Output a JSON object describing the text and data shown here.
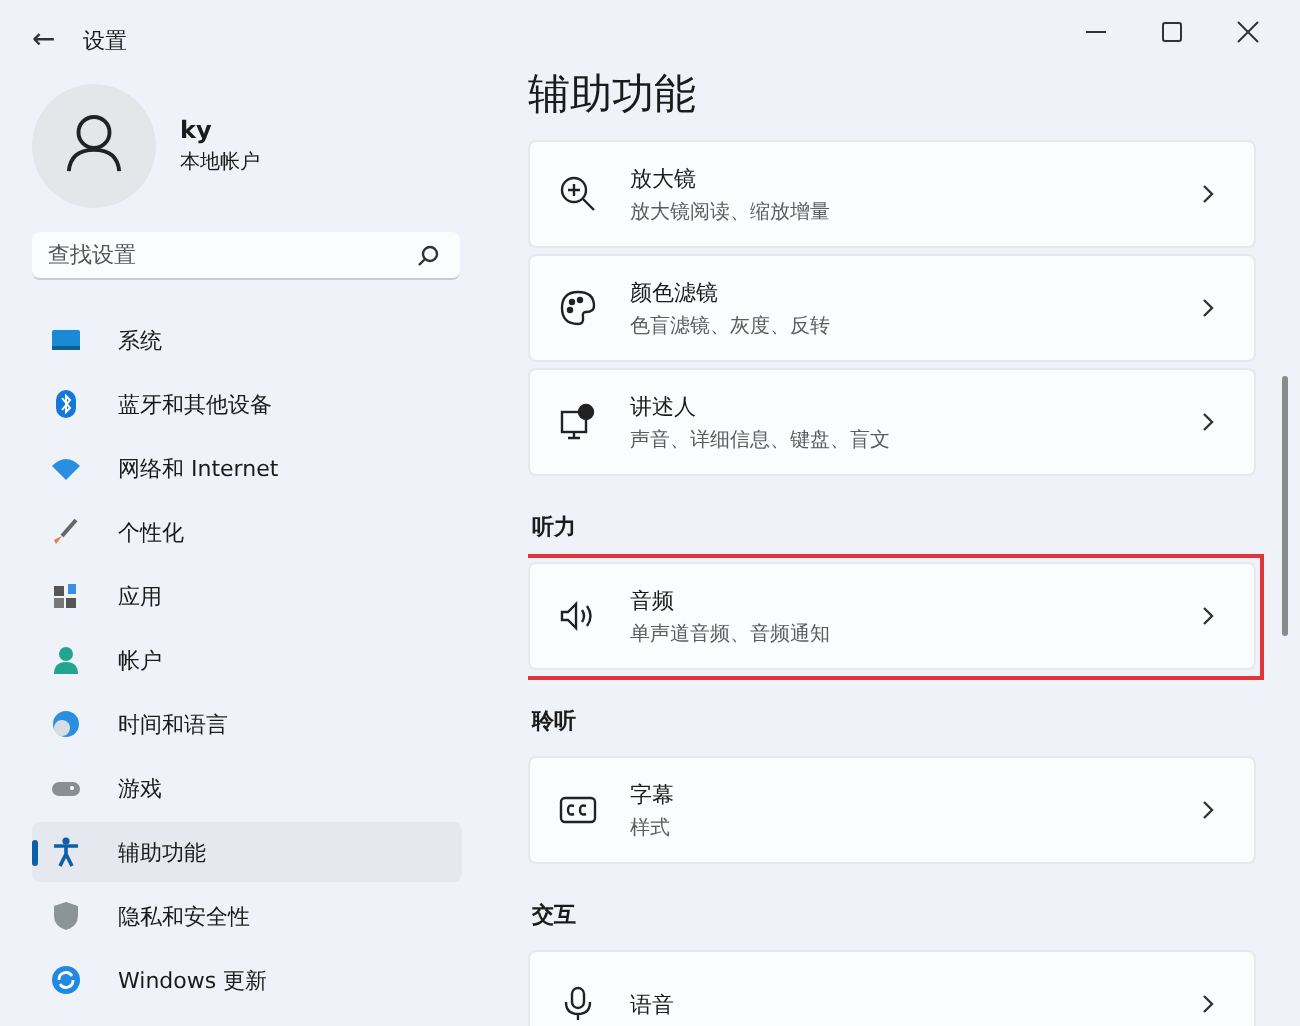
{
  "window": {
    "title": "设置",
    "back": "←"
  },
  "profile": {
    "name": "ky",
    "account": "本地帐户"
  },
  "search": {
    "placeholder": "查找设置"
  },
  "sidebar": {
    "items": [
      {
        "label": "系统",
        "kind": "system",
        "selected": false
      },
      {
        "label": "蓝牙和其他设备",
        "kind": "bluetooth",
        "selected": false
      },
      {
        "label": "网络和 Internet",
        "kind": "network",
        "selected": false
      },
      {
        "label": "个性化",
        "kind": "brush",
        "selected": false
      },
      {
        "label": "应用",
        "kind": "apps",
        "selected": false
      },
      {
        "label": "帐户",
        "kind": "account",
        "selected": false
      },
      {
        "label": "时间和语言",
        "kind": "time",
        "selected": false
      },
      {
        "label": "游戏",
        "kind": "game",
        "selected": false
      },
      {
        "label": "辅助功能",
        "kind": "accessibility",
        "selected": true
      },
      {
        "label": "隐私和安全性",
        "kind": "shield",
        "selected": false
      },
      {
        "label": "Windows 更新",
        "kind": "update",
        "selected": false
      }
    ]
  },
  "page": {
    "title": "辅助功能"
  },
  "sections": [
    {
      "items": [
        {
          "title": "放大镜",
          "subtitle": "放大镜阅读、缩放增量",
          "kind": "magnifier",
          "highlighted": false
        },
        {
          "title": "颜色滤镜",
          "subtitle": "色盲滤镜、灰度、反转",
          "kind": "palette",
          "highlighted": false
        },
        {
          "title": "讲述人",
          "subtitle": "声音、详细信息、键盘、盲文",
          "kind": "narrator",
          "highlighted": false
        }
      ]
    },
    {
      "heading": "听力",
      "items": [
        {
          "title": "音频",
          "subtitle": "单声道音频、音频通知",
          "kind": "speaker",
          "highlighted": true
        }
      ]
    },
    {
      "heading": "聆听",
      "items": [
        {
          "title": "字幕",
          "subtitle": "样式",
          "kind": "captions",
          "highlighted": false
        }
      ]
    },
    {
      "heading": "交互",
      "items": [
        {
          "title": "语音",
          "kind": "mic",
          "highlighted": false
        }
      ]
    }
  ]
}
